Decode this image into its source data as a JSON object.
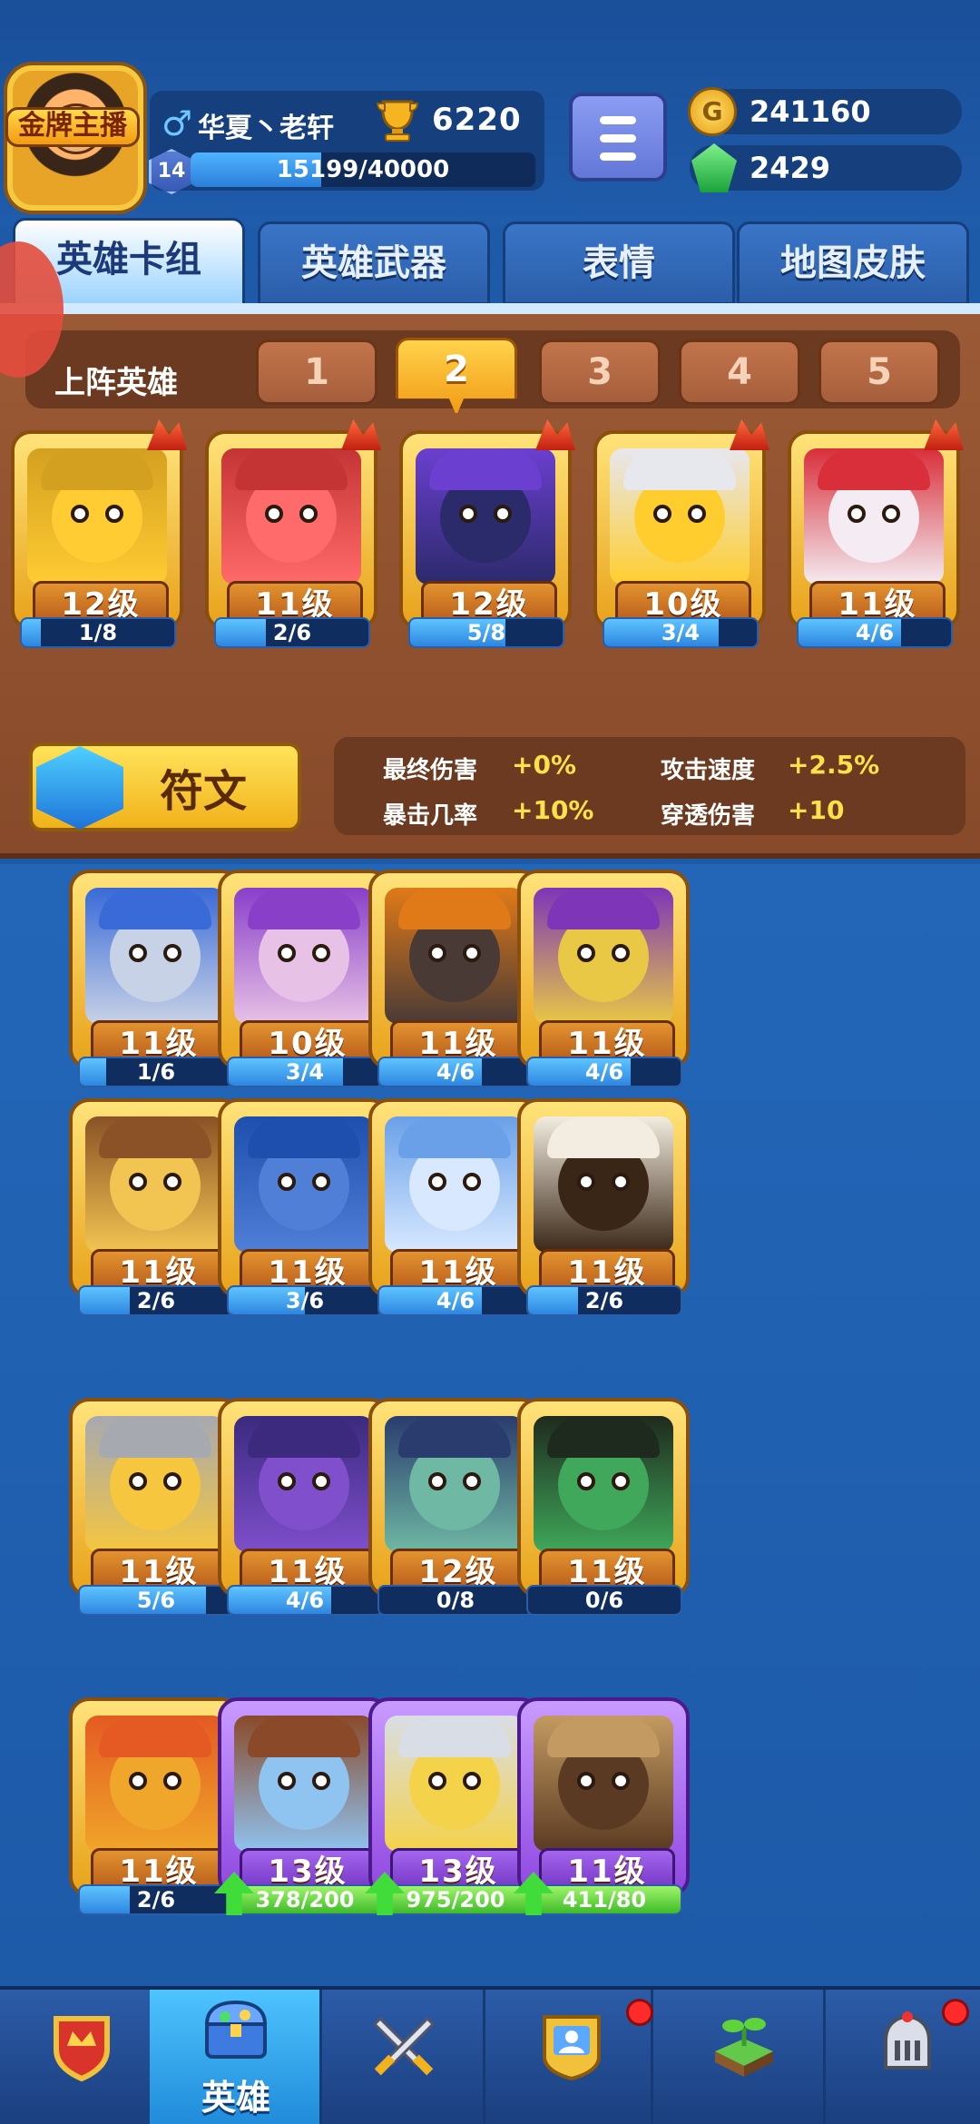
{
  "player": {
    "badge": "金牌主播",
    "name": "华夏丶老轩",
    "trophies": "6220",
    "level": "14",
    "xp_text": "15199/40000",
    "xp_progress": 0.38
  },
  "currency": {
    "coins": "241160",
    "gems": "2429",
    "coin_symbol": "G"
  },
  "tabs": [
    {
      "label": "英雄卡组",
      "active": true
    },
    {
      "label": "英雄武器",
      "active": false
    },
    {
      "label": "表情",
      "active": false
    },
    {
      "label": "地图皮肤",
      "active": false
    }
  ],
  "team": {
    "label": "上阵英雄",
    "slots": [
      "1",
      "2",
      "3",
      "4",
      "5"
    ],
    "active_slot": "2"
  },
  "lineup": [
    {
      "level": "12级",
      "cards": "1/8",
      "progress": 0.125,
      "color": "#ffcc33",
      "hat": "#d4a020"
    },
    {
      "level": "11级",
      "cards": "2/6",
      "progress": 0.33,
      "color": "#ff6a6a",
      "hat": "#c53434"
    },
    {
      "level": "12级",
      "cards": "5/8",
      "progress": 0.625,
      "color": "#2b2a6a",
      "hat": "#6b3fd0"
    },
    {
      "level": "10级",
      "cards": "3/4",
      "progress": 0.75,
      "color": "#ffce2e",
      "hat": "#e7e7ee"
    },
    {
      "level": "11级",
      "cards": "4/6",
      "progress": 0.67,
      "color": "#f4ecf2",
      "hat": "#d82f3a"
    }
  ],
  "rune": {
    "label": "符文",
    "buffs": [
      {
        "label": "最终伤害",
        "value": "+0%"
      },
      {
        "label": "攻击速度",
        "value": "+2.5%"
      },
      {
        "label": "暴击几率",
        "value": "+10%"
      },
      {
        "label": "穿透伤害",
        "value": "+10"
      }
    ]
  },
  "heroes": [
    {
      "level": "11级",
      "cards": "1/6",
      "progress": 0.17,
      "color": "#c8d2e6",
      "hat": "#3a6ad8"
    },
    {
      "level": "10级",
      "cards": "3/4",
      "progress": 0.75,
      "color": "#e7c2e6",
      "hat": "#8a3fc9"
    },
    {
      "level": "11级",
      "cards": "4/6",
      "progress": 0.67,
      "color": "#4a3a36",
      "hat": "#e07a18"
    },
    {
      "level": "11级",
      "cards": "4/6",
      "progress": 0.67,
      "color": "#e8c844",
      "hat": "#7e35b8"
    },
    {
      "level": "11级",
      "cards": "2/6",
      "progress": 0.33,
      "color": "#f2c552",
      "hat": "#8a5226"
    },
    {
      "level": "11级",
      "cards": "3/6",
      "progress": 0.5,
      "color": "#4f7fd6",
      "hat": "#1f4fae"
    },
    {
      "level": "11级",
      "cards": "4/6",
      "progress": 0.67,
      "color": "#d8e9ff",
      "hat": "#6aa0e8"
    },
    {
      "level": "11级",
      "cards": "2/6",
      "progress": 0.33,
      "color": "#3a2616",
      "hat": "#f2ede0"
    },
    {
      "level": "11级",
      "cards": "5/6",
      "progress": 0.83,
      "color": "#f5c63e",
      "hat": "#a7a9b0"
    },
    {
      "level": "11级",
      "cards": "4/6",
      "progress": 0.67,
      "color": "#7f4fcc",
      "hat": "#3b2a7e"
    },
    {
      "level": "12级",
      "cards": "0/8",
      "progress": 0.0,
      "color": "#6fb8a3",
      "hat": "#2a3c6e"
    },
    {
      "level": "11级",
      "cards": "0/6",
      "progress": 0.0,
      "color": "#3fa85a",
      "hat": "#1f2a1e"
    },
    {
      "level": "11级",
      "cards": "2/6",
      "progress": 0.33,
      "color": "#f0a62a",
      "hat": "#e45a22"
    },
    {
      "level": "13级",
      "cards": "378/200",
      "progress": 1.0,
      "color": "#8fc3f0",
      "hat": "#8a4a2a",
      "purple": true,
      "upgrade": true
    },
    {
      "level": "13级",
      "cards": "975/200",
      "progress": 1.0,
      "color": "#f4d24a",
      "hat": "#d9dde6",
      "purple": true,
      "upgrade": true
    },
    {
      "level": "11级",
      "cards": "411/80",
      "progress": 1.0,
      "color": "#5a3a22",
      "hat": "#c29a62",
      "purple": true,
      "upgrade": true
    }
  ],
  "nav": [
    {
      "label": "",
      "icon": "crown-shield-icon",
      "active": false,
      "notify": false
    },
    {
      "label": "英雄",
      "icon": "treasure-chest-icon",
      "active": true,
      "notify": false
    },
    {
      "label": "",
      "icon": "crossed-swords-icon",
      "active": false,
      "notify": false
    },
    {
      "label": "",
      "icon": "guild-icon",
      "active": false,
      "notify": true
    },
    {
      "label": "",
      "icon": "sprout-icon",
      "active": false,
      "notify": false
    },
    {
      "label": "",
      "icon": "knight-helmet-icon",
      "active": false,
      "notify": true
    }
  ],
  "colors": {
    "background": "#1d5aa8",
    "panel_brown": "#874a2a",
    "gold": "#ffd34c",
    "buff_value": "#ffe04a"
  }
}
